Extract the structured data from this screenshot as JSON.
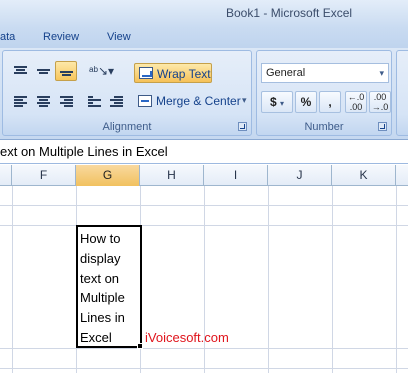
{
  "window": {
    "title": "Book1 - Microsoft Excel"
  },
  "ribbon": {
    "tabs": [
      "ata",
      "Review",
      "View"
    ],
    "alignment": {
      "label": "Alignment",
      "wrap_text": "Wrap Text",
      "merge_center": "Merge & Center",
      "dropdown_glyph": "▾"
    },
    "number": {
      "label": "Number",
      "format_value": "General",
      "dropdown_glyph": "▾",
      "currency": "$",
      "percent": "%",
      "comma": ",",
      "inc_decimal": "←.0\n.00",
      "dec_decimal": ".00\n→.0"
    }
  },
  "formula_bar": {
    "content": "ext on Multiple Lines in Excel"
  },
  "columns": [
    "F",
    "G",
    "H",
    "I",
    "J",
    "K"
  ],
  "selected_column": "G",
  "cell": {
    "text": "How to\ndisplay\ntext on\nMultiple\nLines in\nExcel"
  },
  "watermark": "iVoicesoft.com",
  "colors": {
    "accent": "#15428b",
    "selected_header": "#f1c15f",
    "watermark": "#e0141c"
  }
}
